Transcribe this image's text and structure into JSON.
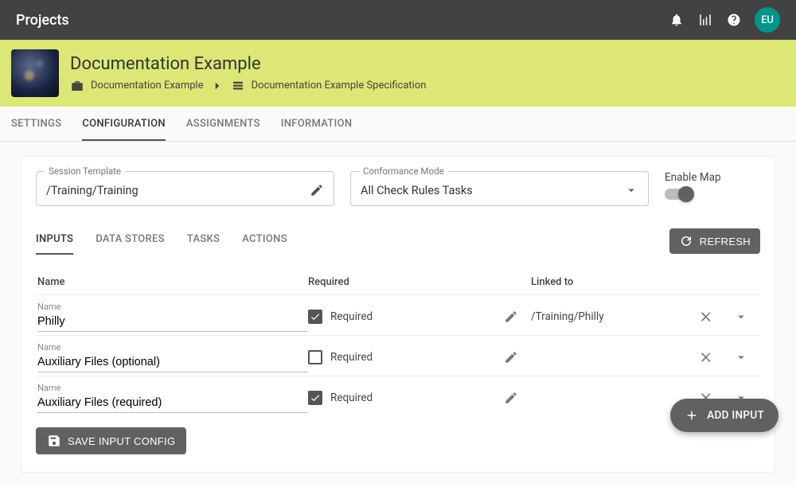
{
  "appbar": {
    "title": "Projects",
    "avatar": "EU"
  },
  "banner": {
    "title": "Documentation Example",
    "breadcrumb": {
      "root": "Documentation Example",
      "leaf": "Documentation Example Specification"
    }
  },
  "tabs": {
    "settings": "SETTINGS",
    "configuration": "CONFIGURATION",
    "assignments": "ASSIGNMENTS",
    "information": "INFORMATION",
    "active": "configuration"
  },
  "config": {
    "session_template": {
      "label": "Session Template",
      "value": "/Training/Training"
    },
    "conformance_mode": {
      "label": "Conformance Mode",
      "value": "All Check Rules Tasks"
    },
    "enable_map": {
      "label": "Enable Map",
      "value": true
    }
  },
  "subtabs": {
    "inputs": "INPUTS",
    "data_stores": "DATA STORES",
    "tasks": "TASKS",
    "actions": "ACTIONS",
    "active": "inputs"
  },
  "refresh_label": "REFRESH",
  "table": {
    "headers": {
      "name": "Name",
      "required": "Required",
      "linked": "Linked to"
    },
    "name_field_label": "Name",
    "required_label": "Required",
    "rows": [
      {
        "name": "Philly",
        "required": true,
        "linked_to": "/Training/Philly"
      },
      {
        "name": "Auxiliary Files (optional)",
        "required": false,
        "linked_to": ""
      },
      {
        "name": "Auxiliary Files (required)",
        "required": true,
        "linked_to": ""
      }
    ]
  },
  "save_button": "SAVE INPUT CONFIG",
  "fab_label": "ADD INPUT"
}
